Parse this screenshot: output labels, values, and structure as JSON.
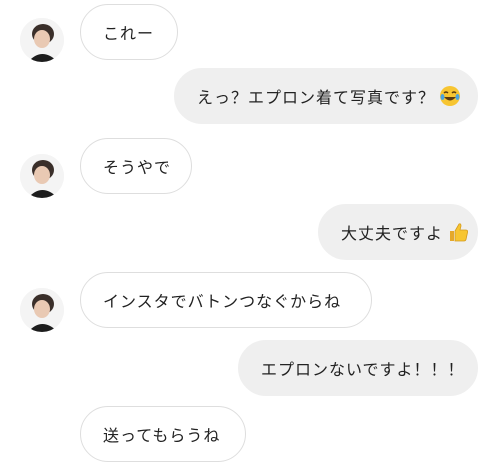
{
  "messages": [
    {
      "side": "in",
      "text": "これー"
    },
    {
      "side": "out",
      "text": "えっ？エプロン着て写真です？",
      "emoji": "tears-of-joy-emoji"
    },
    {
      "side": "in",
      "text": "そうやで"
    },
    {
      "side": "out",
      "text": "大丈夫ですよ",
      "emoji": "thumbs-up-emoji"
    },
    {
      "side": "in",
      "text": "インスタでバトンつなぐからね"
    },
    {
      "side": "out",
      "text": "エプロンないですよ！！！"
    },
    {
      "side": "in",
      "text": "送ってもらうね"
    }
  ],
  "colors": {
    "incoming_bubble_bg": "#ffffff",
    "incoming_bubble_border": "#dedede",
    "outgoing_bubble_bg": "#efefef",
    "text": "#222222"
  }
}
